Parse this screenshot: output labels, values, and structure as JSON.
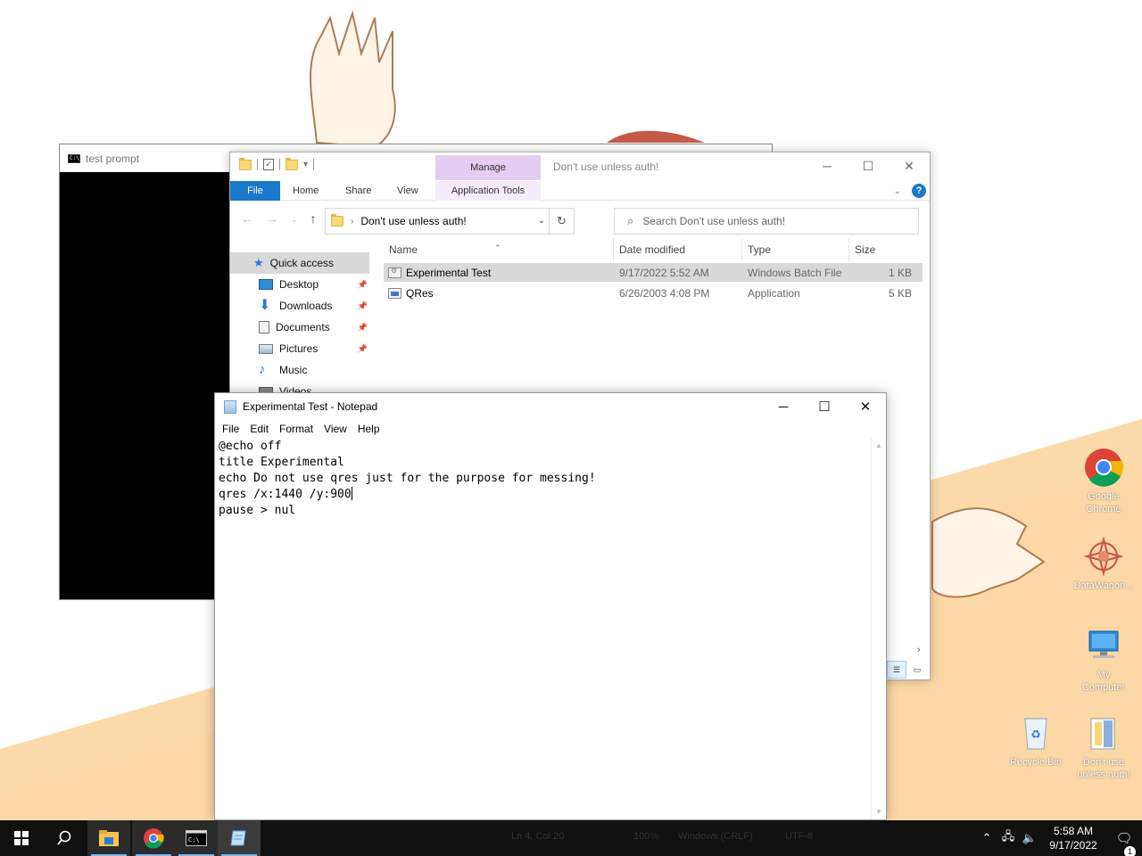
{
  "cmd": {
    "title": "test prompt"
  },
  "explorer": {
    "title": "Don't use unless auth!",
    "manage_tab": "Manage",
    "ribbon": {
      "file": "File",
      "home": "Home",
      "share": "Share",
      "view": "View",
      "app_tools": "Application Tools"
    },
    "address": "Don't use unless auth!",
    "search_placeholder": "Search Don't use unless auth!",
    "nav": {
      "quick_access": "Quick access",
      "items": [
        {
          "label": "Desktop",
          "icon": "desktop-icon",
          "pinned": true
        },
        {
          "label": "Downloads",
          "icon": "downloads-icon",
          "pinned": true
        },
        {
          "label": "Documents",
          "icon": "documents-icon",
          "pinned": true
        },
        {
          "label": "Pictures",
          "icon": "pictures-icon",
          "pinned": true
        },
        {
          "label": "Music",
          "icon": "music-icon",
          "pinned": false
        },
        {
          "label": "Videos",
          "icon": "videos-icon",
          "pinned": false
        }
      ]
    },
    "columns": {
      "name": "Name",
      "date": "Date modified",
      "type": "Type",
      "size": "Size"
    },
    "files": [
      {
        "name": "Experimental Test",
        "date": "9/17/2022 5:52 AM",
        "type": "Windows Batch File",
        "size": "1 KB",
        "selected": true
      },
      {
        "name": "QRes",
        "date": "6/26/2003 4:08 PM",
        "type": "Application",
        "size": "5 KB",
        "selected": false
      }
    ]
  },
  "notepad": {
    "title": "Experimental Test - Notepad",
    "menu": {
      "file": "File",
      "edit": "Edit",
      "format": "Format",
      "view": "View",
      "help": "Help"
    },
    "lines": [
      "@echo off",
      "title Experimental",
      "echo Do not use qres just for the purpose for messing!",
      "qres /x:1440 /y:900",
      "pause > nul"
    ],
    "status": {
      "position": "Ln 4, Col 20",
      "zoom": "100%",
      "eol": "Windows (CRLF)",
      "encoding": "UTF-8"
    }
  },
  "desktop_icons": [
    {
      "label_line1": "Google",
      "label_line2": "Chrome",
      "icon": "chrome-icon"
    },
    {
      "label_line1": "DataWagon...",
      "label_line2": "",
      "icon": "datawagon-icon"
    },
    {
      "label_line1": "My",
      "label_line2": "Computer",
      "icon": "computer-icon"
    },
    {
      "label_line1": "Recycle Bin",
      "label_line2": "",
      "icon": "recycle-bin-icon"
    },
    {
      "label_line1": "Don't use",
      "label_line2": "unless auth!",
      "icon": "folder-icon"
    }
  ],
  "taskbar": {
    "time": "5:58 AM",
    "date": "9/17/2022",
    "notification_count": "1"
  },
  "colors": {
    "accent": "#1979ca",
    "wallpaper_orange": "#fbd8a5",
    "manage_tab": "#e3cdf2"
  }
}
